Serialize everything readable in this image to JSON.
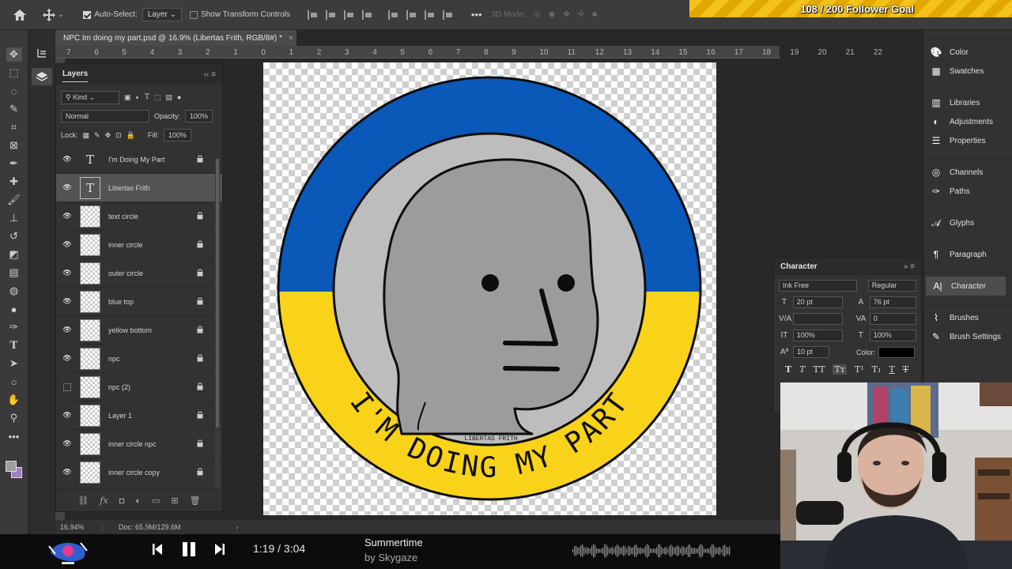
{
  "options_bar": {
    "auto_select_label": "Auto-Select:",
    "auto_select_value": "Layer",
    "transform_controls_label": "Show Transform Controls",
    "mode_3d_label": "3D Mode:",
    "more_label": "•••"
  },
  "overlay": {
    "follower_goal": "108 / 200 Follower Goal"
  },
  "document": {
    "tab_title": "NPC Im doing my part.psd @ 16.9% (Libertas Frith, RGB/8#) *",
    "close_symbol": "×"
  },
  "ruler": {
    "ticks": [
      "7",
      "6",
      "5",
      "4",
      "3",
      "2",
      "1",
      "0",
      "1",
      "2",
      "3",
      "4",
      "5",
      "6",
      "7",
      "8",
      "9",
      "10",
      "11",
      "12",
      "13",
      "14",
      "15",
      "16",
      "17",
      "18",
      "19",
      "20",
      "21",
      "22"
    ]
  },
  "layers_panel": {
    "title": "Layers",
    "filter_kind": "Kind",
    "blend_mode": "Normal",
    "opacity_label": "Opacity:",
    "opacity_value": "100%",
    "lock_label": "Lock:",
    "fill_label": "Fill:",
    "fill_value": "100%",
    "layers": [
      {
        "name": "I'm Doing My Part",
        "type": "text",
        "visible": true,
        "locked": true,
        "selected": false
      },
      {
        "name": "Libertas Frith",
        "type": "text",
        "visible": true,
        "locked": false,
        "selected": true
      },
      {
        "name": "text circle",
        "type": "pixel",
        "visible": true,
        "locked": true,
        "selected": false
      },
      {
        "name": "inner circle",
        "type": "pixel",
        "visible": true,
        "locked": true,
        "selected": false
      },
      {
        "name": "outer circle",
        "type": "pixel",
        "visible": true,
        "locked": true,
        "selected": false
      },
      {
        "name": "blue top",
        "type": "pixel",
        "visible": true,
        "locked": true,
        "selected": false
      },
      {
        "name": "yellow bottom",
        "type": "pixel",
        "visible": true,
        "locked": true,
        "selected": false
      },
      {
        "name": "npc",
        "type": "pixel",
        "visible": true,
        "locked": true,
        "selected": false
      },
      {
        "name": "npc (2)",
        "type": "pixel",
        "visible": false,
        "locked": true,
        "selected": false
      },
      {
        "name": "Layer 1",
        "type": "pixel",
        "visible": true,
        "locked": true,
        "selected": false
      },
      {
        "name": "inner circle npc",
        "type": "pixel",
        "visible": true,
        "locked": true,
        "selected": false
      },
      {
        "name": "inner circle copy",
        "type": "pixel",
        "visible": true,
        "locked": true,
        "selected": false
      }
    ],
    "footer_fx": "fx"
  },
  "status_bar": {
    "zoom": "16.94%",
    "doc_info": "Doc: 65.9M/129.6M"
  },
  "right_panels": {
    "items": [
      {
        "label": "Color",
        "icon": "palette-icon"
      },
      {
        "label": "Swatches",
        "icon": "grid-icon"
      },
      {
        "label": "Libraries",
        "icon": "library-icon"
      },
      {
        "label": "Adjustments",
        "icon": "adjustments-icon"
      },
      {
        "label": "Properties",
        "icon": "sliders-icon"
      },
      {
        "label": "Channels",
        "icon": "channels-icon"
      },
      {
        "label": "Paths",
        "icon": "pen-path-icon"
      },
      {
        "label": "Glyphs",
        "icon": "glyph-icon"
      },
      {
        "label": "Paragraph",
        "icon": "pilcrow-icon"
      },
      {
        "label": "Character",
        "icon": "character-icon"
      },
      {
        "label": "Brushes",
        "icon": "brushes-icon"
      },
      {
        "label": "Brush Settings",
        "icon": "brush-settings-icon"
      }
    ]
  },
  "character_panel": {
    "title": "Character",
    "font_family": "Ink Free",
    "font_style": "Regular",
    "font_size": "20 pt",
    "leading": "76 pt",
    "kerning": "",
    "tracking": "0",
    "vertical_scale": "100%",
    "horizontal_scale": "100%",
    "baseline_shift": "10 pt",
    "color_label": "Color:",
    "color_value": "#000000"
  },
  "artwork": {
    "arc_text": "I'M DOING MY PART",
    "signature": "LIBERTAS FRITH",
    "blue": "#0a58b8",
    "yellow": "#f9d21a"
  },
  "music_player": {
    "time": "1:19 / 3:04",
    "song": "Summertime",
    "artist": "by Skygaze"
  }
}
